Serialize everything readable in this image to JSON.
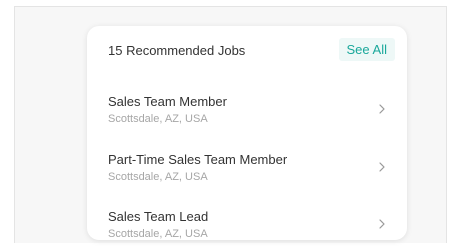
{
  "card": {
    "title": "15 Recommended Jobs",
    "see_all_label": "See All"
  },
  "jobs": [
    {
      "title": "Sales Team Member",
      "location": "Scottsdale, AZ, USA"
    },
    {
      "title": "Part-Time Sales Team Member",
      "location": "Scottsdale, AZ, USA"
    },
    {
      "title": "Sales Team Lead",
      "location": "Scottsdale, AZ, USA"
    }
  ],
  "icons": {
    "job_item_chevron": "chevron-right-icon"
  },
  "colors": {
    "accent": "#1aa89b",
    "accent_background": "#eef8f7",
    "primary_text": "#333333",
    "secondary_text": "#a6a6a6",
    "panel_background": "#f7f7f7"
  }
}
